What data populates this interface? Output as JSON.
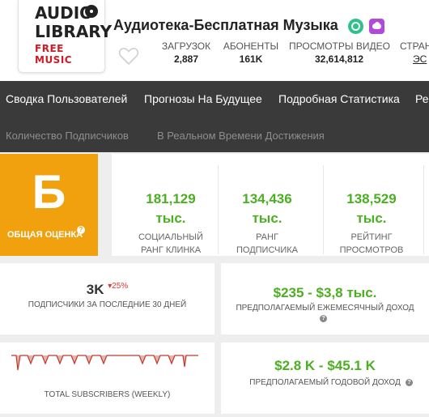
{
  "channel": {
    "logo_line1": "AUDIO",
    "logo_line2": "LIBRARY",
    "logo_line3": "FREE MUSIC",
    "name": "Аудиотека-Бесплатная Музыка"
  },
  "header_stats": [
    {
      "label": "ЗАГРУЗОК",
      "value": "2,887"
    },
    {
      "label": "АБОНЕНТЫ",
      "value": "161K"
    },
    {
      "label": "ПРОСМОТРЫ ВИДЕО",
      "value": "32,614,812"
    },
    {
      "label": "СТРАН",
      "value": "ЭС"
    }
  ],
  "nav": [
    "Сводка Пользователей",
    "Прогнозы На Будущее",
    "Подробная Статистика",
    "Ре"
  ],
  "subnav": [
    "Количество Подписчиков",
    "В Реальном Времени Достижения"
  ],
  "grade": {
    "letter": "Б",
    "label": "ОБЩАЯ ОЦЕНКА",
    "help": "?"
  },
  "ranks": [
    {
      "value": "181,129",
      "unit": "тыс.",
      "label_line1": "СОЦИАЛЬНЫЙ",
      "label_line2": "РАНГ КЛИНКА"
    },
    {
      "value": "134,436",
      "unit": "тыс.",
      "label_line1": "РАНГ",
      "label_line2": "ПОДПИСЧИКА"
    },
    {
      "value": "138,529",
      "unit": "тыс.",
      "label_line1": "РЕЙТИНГ",
      "label_line2": "ПРОСМОТРОВ"
    }
  ],
  "subs_30d": {
    "value": "3K",
    "delta": "25%",
    "label": "ПОДПИСЧИКИ ЗА ПОСЛЕДНИЕ 30 ДНЕЙ"
  },
  "monthly_income": {
    "value": "$235 - $3,8 тыс.",
    "label": "ПРЕДПОЛАГАЕМЫЙ ЕЖЕМЕСЯЧНЫЙ ДОХОД",
    "help": "?"
  },
  "weekly": {
    "label": "TOTAL SUBSCRIBERS (WEEKLY)"
  },
  "yearly_income": {
    "value": "$2.8 K - $45.1 K",
    "label": "ПРЕДПОЛАГАЕМЫЙ ГОДОВОЙ ДОХОД",
    "help": "?"
  },
  "colors": {
    "accent_green": "#4caf22",
    "grade_orange": "#f1a10d",
    "nav_dark": "#3a3a3a",
    "sparkline_red": "#c0392b",
    "delta_red": "#e2342b"
  },
  "icons": [
    "heart-icon",
    "clock-badge-icon",
    "cloud-upload-badge-icon",
    "help-icon",
    "caret-down-icon"
  ]
}
